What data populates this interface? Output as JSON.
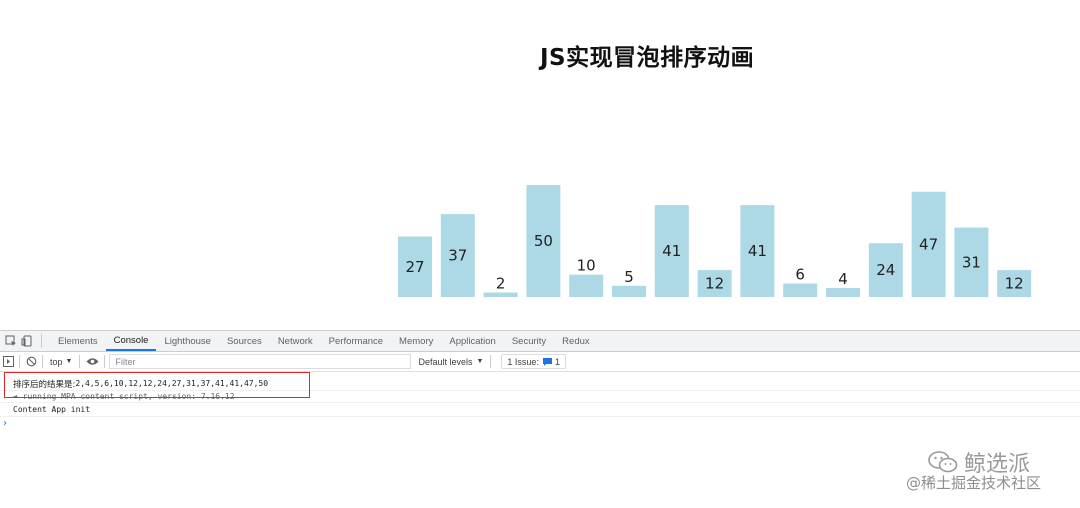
{
  "page": {
    "title": "JS实现冒泡排序动画"
  },
  "chart_data": {
    "type": "bar",
    "values": [
      27,
      37,
      2,
      50,
      10,
      5,
      41,
      12,
      41,
      6,
      4,
      24,
      47,
      31,
      12
    ],
    "bar_color": "#add8e6",
    "label_color": "#222222"
  },
  "devtools": {
    "tabs": [
      "Elements",
      "Console",
      "Lighthouse",
      "Sources",
      "Network",
      "Performance",
      "Memory",
      "Application",
      "Security",
      "Redux"
    ],
    "active_tab": "Console",
    "toolbar": {
      "context": "top",
      "filter_placeholder": "Filter",
      "levels": "Default levels",
      "issues_label": "1 Issue:",
      "issues_count": "1"
    },
    "console": {
      "result_prefix": "排序后的结果是:",
      "result_values": " 2,4,5,6,10,12,12,24,27,31,37,41,41,47,50",
      "line2": "➔ running MPA content script, version: 7.16.12",
      "line3": "Content App init",
      "prompt": "›"
    }
  },
  "watermark": {
    "brand": "鲸选派",
    "site": "@稀土掘金技术社区"
  },
  "colors": {
    "accent": "#1a73e8",
    "highlight": "#e0262b"
  }
}
